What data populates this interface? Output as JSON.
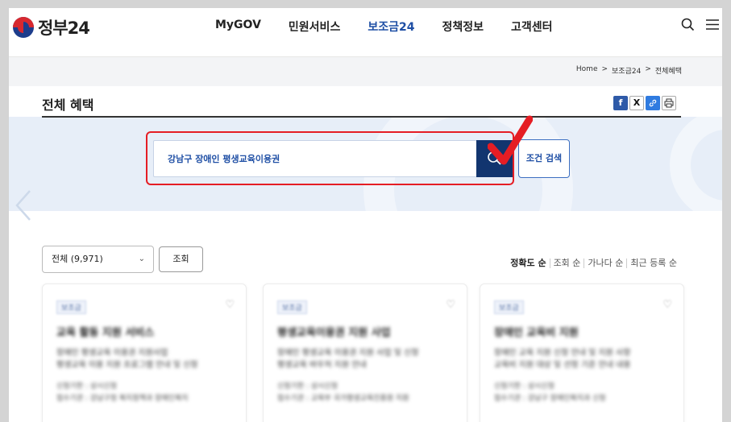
{
  "header": {
    "logo_text": "정부24",
    "nav": [
      "MyGOV",
      "민원서비스",
      "보조금24",
      "정책정보",
      "고객센터"
    ],
    "active_nav_index": 2,
    "accent_color": "#1f4fa5"
  },
  "breadcrumb": [
    "Home",
    ">",
    "보조금24",
    ">",
    "전체혜택"
  ],
  "page_title": "전체 혜택",
  "share_icons": [
    "facebook-icon",
    "x-icon",
    "link-icon",
    "print-icon"
  ],
  "search": {
    "value": "강남구 장애인 평생교육이용권",
    "button_icon": "search-icon",
    "condition_button": "조건 검색",
    "highlight_color": "#e51d24"
  },
  "filter": {
    "select_value": "전체 (9,971)",
    "inquiry_button": "조회"
  },
  "sort_options": [
    "정확도 순",
    "조회 순",
    "가나다 순",
    "최근 등록 순"
  ],
  "cards": [
    {
      "badge": "보조금",
      "title": "교육 활동 지원 서비스",
      "desc": [
        "장애인 평생교육 이용권 지원사업",
        "평생교육 이용 지원 프로그램 안내 및 신청"
      ],
      "meta": [
        "신청기한 : 상시신청",
        "접수기관 : 강남구청 복지정책과 장애인복지"
      ]
    },
    {
      "badge": "보조금",
      "title": "평생교육이용권 지원 사업",
      "desc": [
        "장애인 평생교육 이용권 지원 사업 및 신청",
        "평생교육 바우처 지원 안내"
      ],
      "meta": [
        "신청기한 : 상시신청",
        "접수기관 : 교육부 국가평생교육진흥원 지원"
      ]
    },
    {
      "badge": "보조금",
      "title": "장애인 교육비 지원",
      "desc": [
        "장애인 교육 지원 신청 안내 및 지원 사항",
        "교육비 지원 대상 및 선정 기준 안내 내용"
      ],
      "meta": [
        "신청기한 : 상시신청",
        "접수기관 : 강남구 장애인복지과 신청"
      ]
    }
  ]
}
